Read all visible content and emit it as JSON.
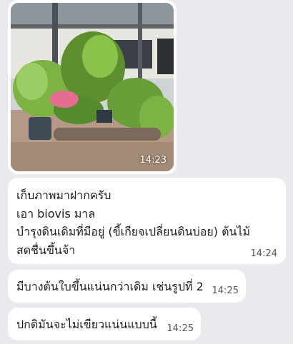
{
  "messages": [
    {
      "type": "image",
      "time": "14:23"
    },
    {
      "type": "text",
      "lines": [
        "เก็บภาพมาฝากครับ",
        "เอา biovis มาล",
        "บำรุงดินเดิมที่มีอยู่ (ขี้เกียจเปลี่ยนดินบ่อย) ต้นไม้",
        "สดชื่นขึ้นจ้า"
      ],
      "time": "14:24"
    },
    {
      "type": "text",
      "text": "มีบางต้นใบขึ้นแน่นกว่าเดิม เช่นรูปที่ 2",
      "time": "14:25"
    },
    {
      "type": "text",
      "text": "ปกติมันจะไม่เขียวแน่นแบบนี้",
      "time": "14:25"
    }
  ],
  "colors": {
    "background": "#e9e9ee",
    "bubble": "#ffffff",
    "time_text": "#555555"
  }
}
